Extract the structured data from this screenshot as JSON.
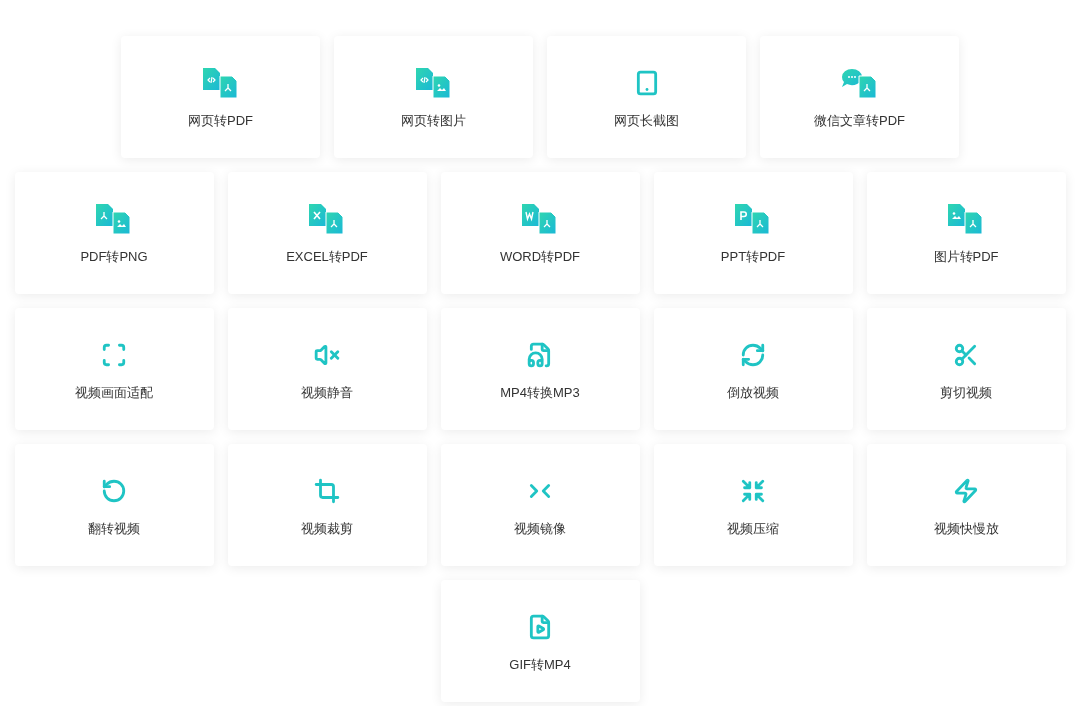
{
  "rows": [
    {
      "tools": [
        {
          "label": "网页转PDF",
          "kind": "code-pdf"
        },
        {
          "label": "网页转图片",
          "kind": "code-image"
        },
        {
          "label": "网页长截图",
          "kind": "tablet"
        },
        {
          "label": "微信文章转PDF",
          "kind": "chat-pdf"
        }
      ]
    },
    {
      "tools": [
        {
          "label": "PDF转PNG",
          "kind": "pdf-image"
        },
        {
          "label": "EXCEL转PDF",
          "kind": "sheet-pdf"
        },
        {
          "label": "WORD转PDF",
          "kind": "word-pdf"
        },
        {
          "label": "PPT转PDF",
          "kind": "slides-pdf"
        },
        {
          "label": "图片转PDF",
          "kind": "image-pdf"
        }
      ]
    },
    {
      "tools": [
        {
          "label": "视频画面适配",
          "kind": "fullscreen"
        },
        {
          "label": "视频静音",
          "kind": "mute"
        },
        {
          "label": "MP4转换MP3",
          "kind": "audio-file"
        },
        {
          "label": "倒放视频",
          "kind": "refresh"
        },
        {
          "label": "剪切视频",
          "kind": "scissors"
        }
      ]
    },
    {
      "tools": [
        {
          "label": "翻转视频",
          "kind": "rotate"
        },
        {
          "label": "视频裁剪",
          "kind": "crop"
        },
        {
          "label": "视频镜像",
          "kind": "mirror"
        },
        {
          "label": "视频压缩",
          "kind": "compress"
        },
        {
          "label": "视频快慢放",
          "kind": "bolt"
        }
      ]
    },
    {
      "tools": [
        {
          "label": "GIF转MP4",
          "kind": "video-file"
        }
      ]
    }
  ]
}
